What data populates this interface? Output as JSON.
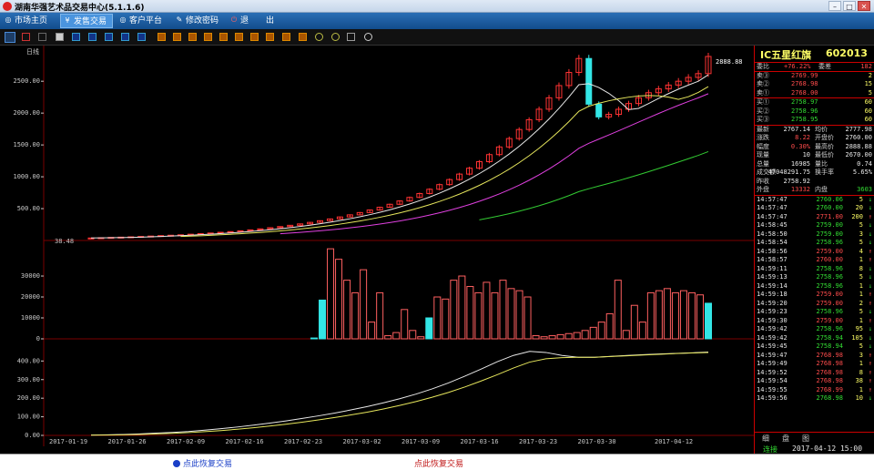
{
  "window": {
    "title": "湖南华强艺术品交易中心(5.1.1.6)",
    "min": "–",
    "max": "□",
    "close": "✕"
  },
  "menu": {
    "items": [
      {
        "label": "市场主页",
        "icon": "◎"
      },
      {
        "label": "发售交易",
        "icon": "¥"
      },
      {
        "label": "客户平台",
        "icon": "◎"
      },
      {
        "label": "修改密码",
        "icon": "✎"
      },
      {
        "label": "退",
        "icon": "⏻"
      },
      {
        "label": "出",
        "icon": ""
      }
    ]
  },
  "chart": {
    "period_label": "日线",
    "price_first_label": "38.48",
    "price_last_label": "2888.88"
  },
  "colors": {
    "up": "#ff3333",
    "down": "#33e6e6",
    "ma5": "#e8e8e8",
    "ma10": "#e6e65c",
    "ma20": "#e040e0",
    "ma60": "#33cc33",
    "ma120": "#e07020"
  },
  "chart_data": [
    {
      "type": "candlestick",
      "title": "日线",
      "x": [
        "2017-01-19",
        "2017-01-26",
        "2017-02-09",
        "2017-02-16",
        "2017-02-23",
        "2017-03-02",
        "2017-03-09",
        "2017-03-16",
        "2017-03-23",
        "2017-03-30",
        "2017-04-12"
      ],
      "ylim": [
        0,
        2888.88
      ],
      "yticks": [
        "2500.00",
        "2000.00",
        "1500.00",
        "1000.00",
        "500.00"
      ],
      "series": [
        {
          "name": "close",
          "values": [
            38.48,
            43,
            48,
            52,
            57,
            63,
            69,
            76,
            82,
            89,
            98,
            107,
            117,
            128,
            139,
            152,
            166,
            182,
            200,
            218,
            238,
            260,
            284,
            310,
            338,
            369,
            402,
            438,
            478,
            521,
            568,
            620,
            676,
            737,
            804,
            877,
            956,
            1042,
            1135,
            1237,
            1348,
            1468,
            1600,
            1742,
            1896,
            2061,
            2240,
            2432,
            2638,
            2857,
            2140,
            1940,
            1980,
            2060,
            2150,
            2240,
            2320,
            2380,
            2440,
            2500,
            2560,
            2620,
            2888.88
          ]
        }
      ]
    },
    {
      "type": "bar",
      "title": "volume",
      "yticks": [
        "30000",
        "20000",
        "10000",
        "0"
      ],
      "series": [
        {
          "name": "volume",
          "values": [
            400,
            18500,
            43000,
            38000,
            28000,
            22000,
            33000,
            8000,
            22000,
            1500,
            3000,
            14000,
            4000,
            1000,
            10000,
            20000,
            19000,
            28000,
            30000,
            25000,
            22000,
            27000,
            22000,
            28000,
            24000,
            23000,
            20000,
            1500,
            1000,
            1500,
            2000,
            2500,
            3000,
            4000,
            5500,
            8000,
            12000,
            28000,
            4000,
            16000,
            8000,
            22000,
            23000,
            24000,
            22000,
            23000,
            22000,
            21000,
            17000
          ]
        }
      ]
    },
    {
      "type": "line",
      "title": "indicator",
      "yticks": [
        "400.00",
        "300.00",
        "200.00",
        "100.00",
        "0.00"
      ],
      "series": [
        {
          "name": "line1",
          "values": [
            2,
            3,
            5,
            8,
            12,
            16,
            21,
            28,
            36,
            45,
            55,
            66,
            78,
            91,
            105,
            120,
            137,
            155,
            175,
            197,
            222,
            250,
            282,
            318,
            356,
            396,
            430,
            452,
            446,
            430,
            420,
            420,
            425,
            430,
            434,
            438,
            441,
            444,
            448
          ]
        },
        {
          "name": "line2",
          "values": [
            1,
            2,
            3,
            5,
            8,
            11,
            15,
            20,
            26,
            33,
            41,
            50,
            60,
            71,
            83,
            96,
            110,
            125,
            142,
            161,
            182,
            205,
            231,
            260,
            292,
            326,
            362,
            394,
            412,
            418,
            420,
            420,
            424,
            428,
            432,
            436,
            440,
            443,
            446
          ]
        }
      ]
    }
  ],
  "quote": {
    "name": "IC五星红旗",
    "code": "602013",
    "weibi": {
      "label": "委比",
      "value": "+76.22%"
    },
    "weicha": {
      "label": "委差",
      "value": "182"
    },
    "sell": [
      {
        "label": "卖③",
        "price": "2769.99",
        "vol": "2"
      },
      {
        "label": "卖②",
        "price": "2768.98",
        "vol": "15"
      },
      {
        "label": "卖①",
        "price": "2768.00",
        "vol": "5"
      }
    ],
    "buy": [
      {
        "label": "买①",
        "price": "2758.97",
        "vol": "60"
      },
      {
        "label": "买②",
        "price": "2758.96",
        "vol": "60"
      },
      {
        "label": "买③",
        "price": "2758.95",
        "vol": "60"
      }
    ],
    "stats": [
      {
        "l1": "最新",
        "v1": "2767.14",
        "l2": "均价",
        "v2": "2777.98"
      },
      {
        "l1": "涨跌",
        "v1": "8.22",
        "l2": "开盘价",
        "v2": "2760.00"
      },
      {
        "l1": "幅度",
        "v1": "0.30%",
        "l2": "最高价",
        "v2": "2888.88"
      },
      {
        "l1": "现量",
        "v1": "10",
        "l2": "最低价",
        "v2": "2670.00"
      },
      {
        "l1": "总量",
        "v1": "16985",
        "l2": "量比",
        "v2": "0.74"
      },
      {
        "l1": "成交额",
        "v1": "47048291.75",
        "l2": "换手率",
        "v2": "5.65%"
      },
      {
        "l1": "昨收",
        "v1": "2758.92",
        "l2": "",
        "v2": ""
      },
      {
        "l1": "外盘",
        "v1": "13332",
        "l2": "内盘",
        "v2": "3603"
      }
    ],
    "ticks": [
      {
        "t": "14:57:47",
        "p": "2760.06",
        "v": "5",
        "d": "↓",
        "c": "g"
      },
      {
        "t": "14:57:47",
        "p": "2760.00",
        "v": "20",
        "d": "↓",
        "c": "g"
      },
      {
        "t": "14:57:47",
        "p": "2771.00",
        "v": "200",
        "d": "↑",
        "c": "r"
      },
      {
        "t": "14:58:45",
        "p": "2759.00",
        "v": "5",
        "d": "↓",
        "c": "g"
      },
      {
        "t": "14:58:50",
        "p": "2759.00",
        "v": "3",
        "d": "↓",
        "c": "g"
      },
      {
        "t": "14:58:54",
        "p": "2758.96",
        "v": "5",
        "d": "↓",
        "c": "g"
      },
      {
        "t": "14:58:56",
        "p": "2759.00",
        "v": "4",
        "d": "↑",
        "c": "r"
      },
      {
        "t": "14:58:57",
        "p": "2760.00",
        "v": "1",
        "d": "↑",
        "c": "r"
      },
      {
        "t": "14:59:11",
        "p": "2758.96",
        "v": "8",
        "d": "↓",
        "c": "g"
      },
      {
        "t": "14:59:13",
        "p": "2758.96",
        "v": "5",
        "d": "↓",
        "c": "g"
      },
      {
        "t": "14:59:14",
        "p": "2758.96",
        "v": "1",
        "d": "↓",
        "c": "g"
      },
      {
        "t": "14:59:18",
        "p": "2759.00",
        "v": "1",
        "d": "↑",
        "c": "r"
      },
      {
        "t": "14:59:20",
        "p": "2759.00",
        "v": "2",
        "d": "↑",
        "c": "r"
      },
      {
        "t": "14:59:23",
        "p": "2758.96",
        "v": "5",
        "d": "↓",
        "c": "g"
      },
      {
        "t": "14:59:30",
        "p": "2759.00",
        "v": "1",
        "d": "↑",
        "c": "r"
      },
      {
        "t": "14:59:42",
        "p": "2758.96",
        "v": "95",
        "d": "↓",
        "c": "g"
      },
      {
        "t": "14:59:42",
        "p": "2758.94",
        "v": "105",
        "d": "↓",
        "c": "g"
      },
      {
        "t": "14:59:45",
        "p": "2758.94",
        "v": "5",
        "d": "↓",
        "c": "g"
      },
      {
        "t": "14:59:47",
        "p": "2768.98",
        "v": "3",
        "d": "↑",
        "c": "r"
      },
      {
        "t": "14:59:49",
        "p": "2768.98",
        "v": "1",
        "d": "↑",
        "c": "r"
      },
      {
        "t": "14:59:52",
        "p": "2768.98",
        "v": "8",
        "d": "↑",
        "c": "r"
      },
      {
        "t": "14:59:54",
        "p": "2768.98",
        "v": "38",
        "d": "↑",
        "c": "r"
      },
      {
        "t": "14:59:55",
        "p": "2768.99",
        "v": "1",
        "d": "↑",
        "c": "r"
      },
      {
        "t": "14:59:56",
        "p": "2768.98",
        "v": "10",
        "d": "↓",
        "c": "g"
      }
    ],
    "tabs": [
      "细",
      "盘",
      "图"
    ]
  },
  "status": {
    "left": "点此恢复交易",
    "right": "点此恢复交易",
    "connection": "连接",
    "datetime": "2017-04-12 15:00"
  }
}
